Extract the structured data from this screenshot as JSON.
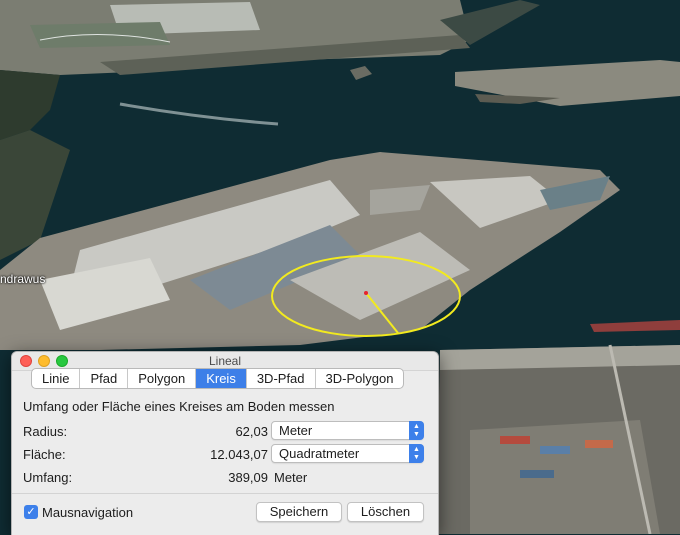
{
  "map": {
    "place_label": "ndrawus"
  },
  "dialog": {
    "title": "Lineal",
    "tabs": [
      {
        "label": "Linie",
        "active": false
      },
      {
        "label": "Pfad",
        "active": false
      },
      {
        "label": "Polygon",
        "active": false
      },
      {
        "label": "Kreis",
        "active": true
      },
      {
        "label": "3D-Pfad",
        "active": false
      },
      {
        "label": "3D-Polygon",
        "active": false
      }
    ],
    "heading": "Umfang oder Fläche eines Kreises am Boden messen",
    "radius": {
      "label": "Radius:",
      "value": "62,03",
      "unit": "Meter"
    },
    "area": {
      "label": "Fläche:",
      "value": "12.043,07",
      "unit": "Quadratmeter"
    },
    "perimeter": {
      "label": "Umfang:",
      "value": "389,09",
      "unit": "Meter"
    },
    "mouse_navigation": {
      "label": "Mausnavigation",
      "checked": true
    },
    "save_label": "Speichern",
    "delete_label": "Löschen"
  },
  "colors": {
    "accent": "#3d7fe8",
    "measure_circle": "#f2ea1f",
    "water": "#0f2c33"
  }
}
